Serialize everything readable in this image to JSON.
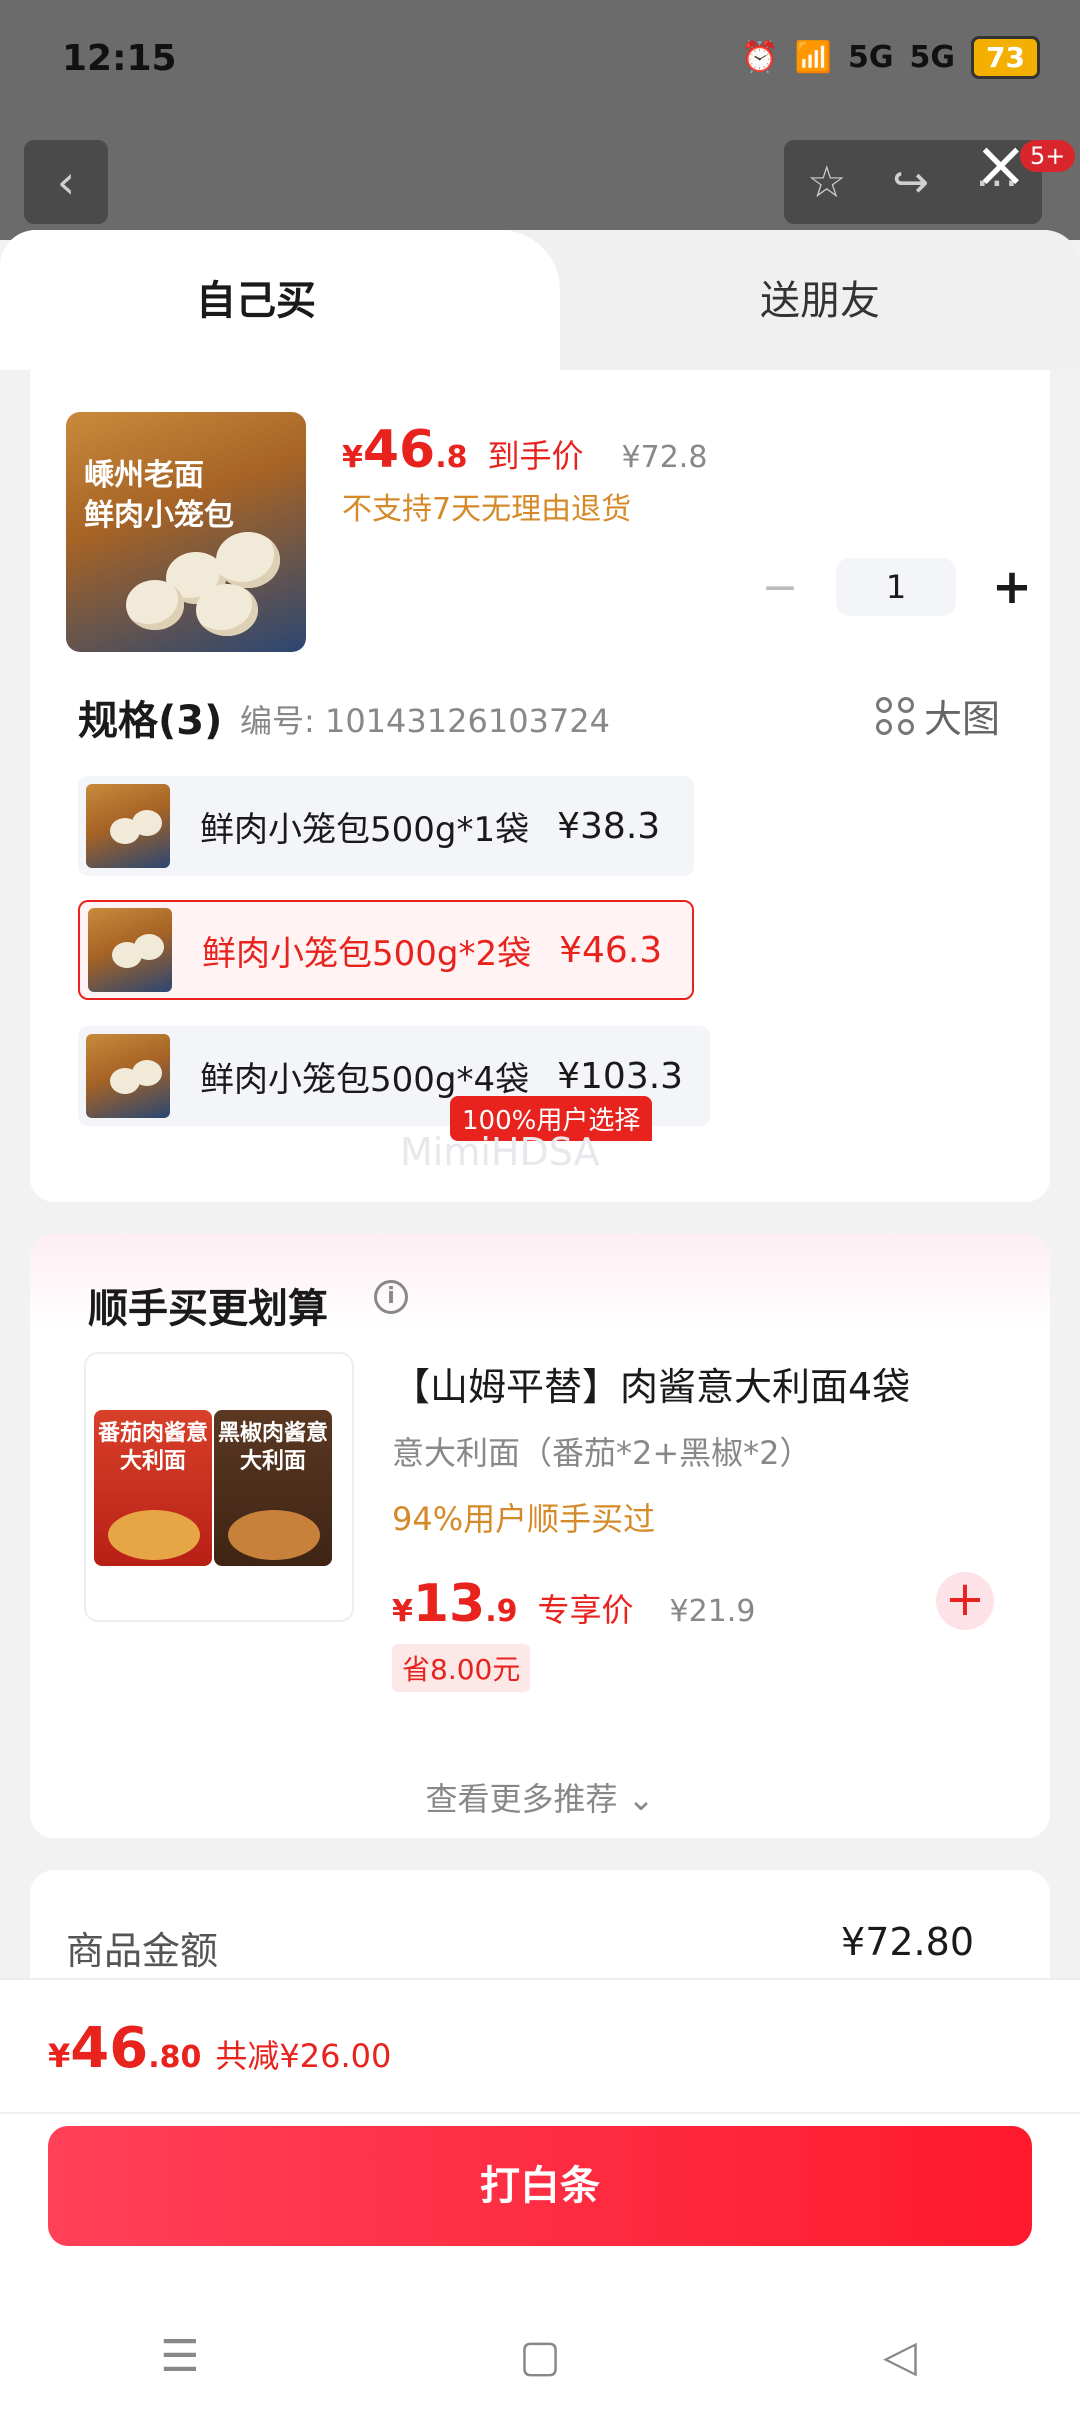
{
  "status_bar": {
    "time": "12:15",
    "battery": "73",
    "signal1": "5G",
    "signal2": "5G"
  },
  "top_bar": {
    "badge": "5+"
  },
  "tabs": {
    "self": "自己买",
    "friend": "送朋友"
  },
  "product": {
    "image_text_line1": "嵊州老面",
    "image_text_line2": "鲜肉小笼包",
    "price_symbol": "¥",
    "price_int": "46",
    "price_dec": ".8",
    "price_label": "到手价",
    "original_price": "¥72.8",
    "return_note": "不支持7天无理由退货",
    "quantity": "1"
  },
  "spec": {
    "title": "规格(3)",
    "code": "编号: 10143126103724",
    "big_image_label": "大图",
    "selected_tag": "100%用户选择",
    "items": [
      {
        "name": "鲜肉小笼包500g*1袋",
        "price": "¥38.3"
      },
      {
        "name": "鲜肉小笼包500g*2袋",
        "price": "¥46.3"
      },
      {
        "name": "鲜肉小笼包500g*4袋",
        "price": "¥103.3"
      }
    ],
    "watermark": "MimiHDSA"
  },
  "bundle": {
    "title": "顺手买更划算",
    "image_left_label": "番茄肉酱意大利面",
    "image_right_label": "黑椒肉酱意大利面",
    "name": "【山姆平替】肉酱意大利面4袋",
    "sub": "意大利面（番茄*2+黑椒*2）",
    "bought": "94%用户顺手买过",
    "price_symbol": "¥",
    "price_int": "13",
    "price_dec": ".9",
    "price_label": "专享价",
    "original_price": "¥21.9",
    "save": "省8.00元",
    "more": "查看更多推荐 ⌄"
  },
  "summary": {
    "label": "商品金额",
    "value": "¥72.80"
  },
  "bottom": {
    "currency": "¥",
    "total_int": "46",
    "total_dec": ".80",
    "discount": "共减¥26.00",
    "pay_label": "打白条"
  },
  "colors": {
    "accent": "#e8231e",
    "orange": "#d58a2a",
    "pay_gradient_start": "#ff4059",
    "pay_gradient_end": "#fe1a2c"
  }
}
